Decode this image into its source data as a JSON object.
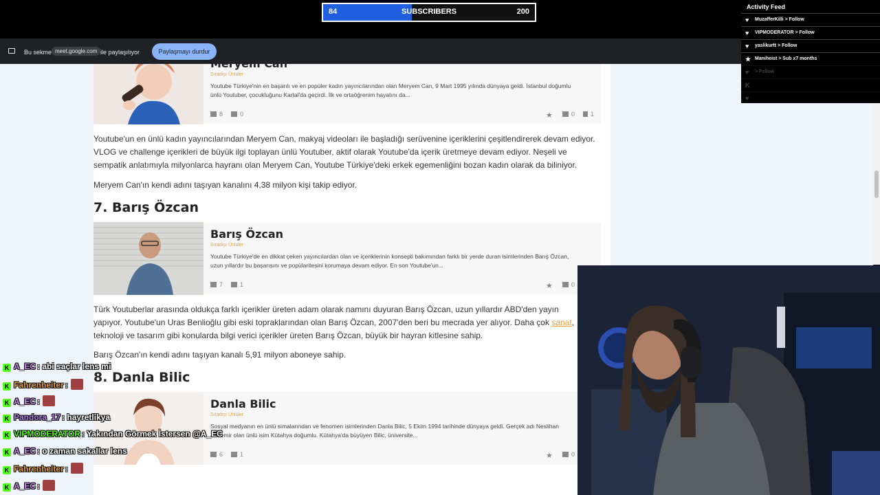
{
  "subscriber_bar": {
    "current": "84",
    "label": "SUBSCRIBERS",
    "goal": "200",
    "progress": 0.42,
    "fill_color": "#1f5fe0"
  },
  "share_bar": {
    "prefix": "Bu sekme",
    "domain": "meet.google.com",
    "suffix": "ile paylaşılıyor",
    "stop_button": "Paylaşmayı durdur"
  },
  "activity_feed": {
    "title": "Activity Feed",
    "items": [
      {
        "icon": "heart-icon",
        "user": "MuzafferKilli",
        "action": "> Follow"
      },
      {
        "icon": "heart-icon",
        "user": "VIPMODERATOR",
        "action": "> Follow"
      },
      {
        "icon": "heart-icon",
        "user": "yaslikurtt",
        "action": "> Follow"
      },
      {
        "icon": "star-icon",
        "user": "Maniheist",
        "action": "> Sub x7 months"
      },
      {
        "icon": "heart-icon",
        "user": "",
        "action": "> Follow"
      },
      {
        "icon": "kick-icon",
        "user": "",
        "action": ""
      },
      {
        "icon": "heart-icon",
        "user": "",
        "action": ""
      }
    ]
  },
  "article": {
    "card_meryem": {
      "name": "Meryem Can",
      "category": "Sıradışı Ünlüler",
      "desc": "Youtube Türkiye'nin en başarılı ve en popüler kadın yayıncılarından olan Meryem Can, 9 Mart 1995 yılında dünyaya geldi. İstanbul doğumlu ünlü Youtuber, çocukluğunu Kartal'da geçirdi. İlk ve ortaöğrenim hayatını da...",
      "likes": "8",
      "dislikes": "0",
      "comments": "0",
      "bookmarks": "1"
    },
    "para1": "Youtube'un en ünlü kadın yayıncılarından Meryem Can, makyaj videoları ile başladığı serüvenine içeriklerini çeşitlendirerek devam ediyor. VLOG ve challenge içerikleri de büyük ilgi toplayan ünlü Youtuber, aktif olarak Youtube'da içerik üretmeye devam ediyor. Neşeli ve sempatik anlatımıyla milyonlarca hayranı olan Meryem Can, Youtube Türkiye'deki erkek egemenliğini bozan kadın olarak da biliniyor.",
    "para2": "Meryem Can'ın kendi adını taşıyan kanalını 4,38 milyon kişi takip ediyor.",
    "heading7": "7. Barış Özcan",
    "card_baris": {
      "name": "Barış Özcan",
      "category": "Sıradışı Ünlüler",
      "desc": "Youtube Türkiye'de en dikkat çeken yayıncılardan olan ve içeriklerinin konsepti bakımından farklı bir yerde duran isimlerinden Barış Özcan, uzun yıllardır bu başarısını ve popülaritesini korumaya devam ediyor. En son Youtube'un...",
      "likes": "7",
      "dislikes": "1",
      "comments": "0"
    },
    "para3a": "Türk Youtuberlar arasında oldukça farklı içerikler üreten adam olarak namını duyuran Barış Özcan, uzun yıllardır ABD'den yayın yapıyor. Youtube'un Uras Benlioğlu gibi eski topraklarından olan Barış Özcan, 2007'den beri bu mecrada yer alıyor. Daha çok ",
    "para3link": "sanat",
    "para3b": ", teknoloji ve tasarım gibi konularda bilgi verici içerikler üreten Barış Özcan, büyük bir hayran kitlesine sahip.",
    "para4": "Barış Özcan'ın kendi adını taşıyan kanalı 5,91 milyon aboneye sahip.",
    "heading8": "8. Danla Bilic",
    "card_danla": {
      "name": "Danla Bilic",
      "category": "Sıradışı Ünlüler",
      "desc": "Sosyal medyanın en ünlü simalarından ve fenomen isimlerinden Danla Bilic, 5 Ekim 1994 tarihinde dünyaya geldi. Gerçek adı Neslihan Akdemir olan ünlü isim Kütahya doğumlu. Kütahya'da büyüyen Bilic, üniversite...",
      "likes": "6",
      "dislikes": "1",
      "comments": "0"
    }
  },
  "chat": [
    {
      "user": "A_EC",
      "color": "#c98be8",
      "msg": ": abi saçlar lens mi"
    },
    {
      "user": "Fahrenheiter",
      "color": "#e8a23b",
      "msg": ":",
      "emote": true
    },
    {
      "user": "A_EC",
      "color": "#c98be8",
      "msg": ":",
      "emote": true
    },
    {
      "user": "Pandora_17",
      "color": "#b080e0",
      "msg": ": hayretlikya"
    },
    {
      "user": "VIPMODERATOR",
      "color": "#53fc18",
      "msg": ": Yakından Görmek İstersen @A_EC"
    },
    {
      "user": "A_EC",
      "color": "#c98be8",
      "msg": ": o zaman sakallar lens"
    },
    {
      "user": "Fahrenheiter",
      "color": "#e8a23b",
      "msg": ":",
      "emote": true
    },
    {
      "user": "A_EC",
      "color": "#c98be8",
      "msg": ":",
      "emote": true
    }
  ]
}
